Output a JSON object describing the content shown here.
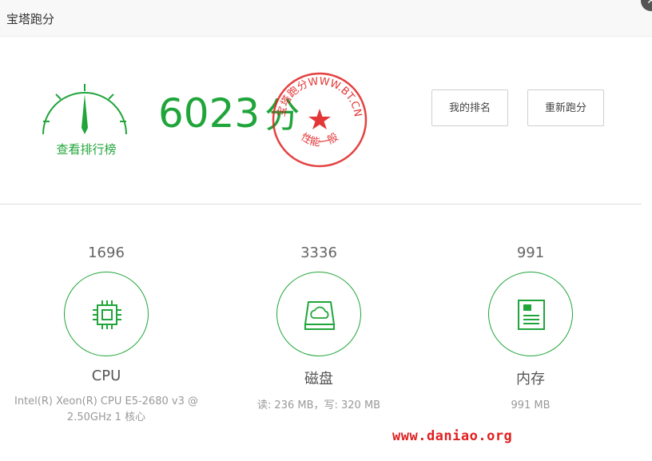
{
  "window": {
    "title": "宝塔跑分",
    "close_glyph": "✕"
  },
  "score": {
    "value": "6023",
    "unit": "分",
    "leaderboard_link": "查看排行榜"
  },
  "stamp": {
    "top_text": "宝塔跑分WWW.BT.CN",
    "bottom_text": "性能一般",
    "color": "#e02020"
  },
  "buttons": {
    "my_rank": "我的排名",
    "rerun": "重新跑分"
  },
  "metrics": [
    {
      "value": "1696",
      "name": "CPU",
      "desc": "Intel(R) Xeon(R) CPU E5-2680 v3 @ 2.50GHz 1 核心",
      "icon": "cpu-icon"
    },
    {
      "value": "3336",
      "name": "磁盘",
      "desc": "读: 236 MB，写: 320 MB",
      "icon": "disk-icon"
    },
    {
      "value": "991",
      "name": "内存",
      "desc": "991 MB",
      "icon": "memory-icon"
    }
  ],
  "watermark": "www.daniao.org",
  "colors": {
    "accent": "#20a53a",
    "stamp_red": "#e02020"
  }
}
